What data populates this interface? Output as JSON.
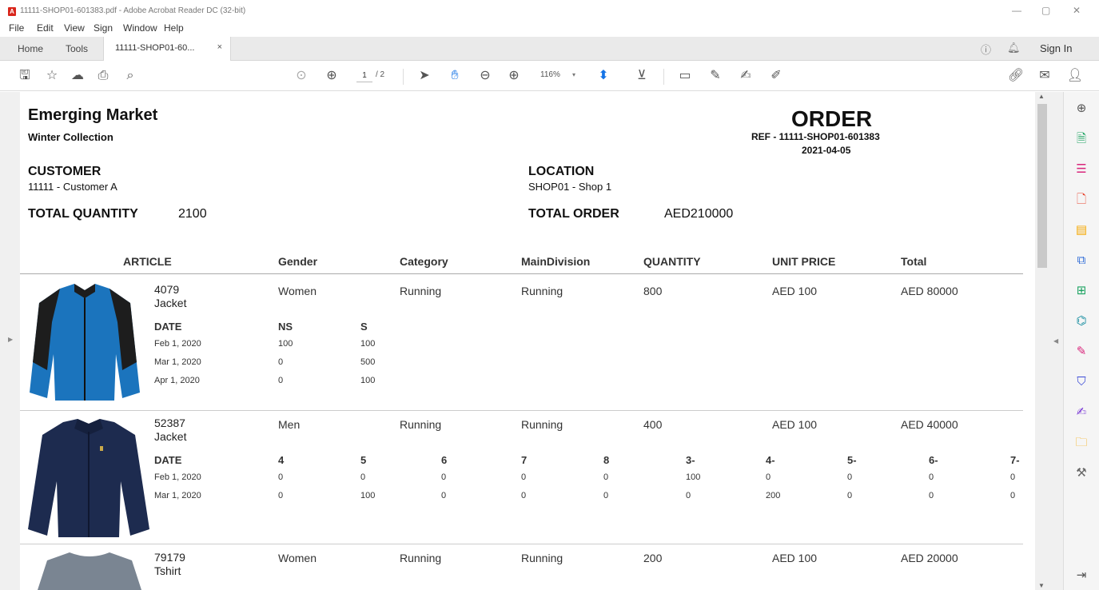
{
  "window": {
    "title": "11111-SHOP01-601383.pdf - Adobe Acrobat Reader DC (32-bit)",
    "minimize": "—",
    "restore": "▢",
    "close": "✕"
  },
  "menu": [
    "File",
    "Edit",
    "View",
    "Sign",
    "Window",
    "Help"
  ],
  "tabs": {
    "home": "Home",
    "tools": "Tools",
    "document": "11111-SHOP01-60...",
    "close": "×",
    "sign_in": "Sign In"
  },
  "toolbar": {
    "page_current": "1",
    "page_total": "/ 2",
    "zoom": "116%"
  },
  "document": {
    "company": "Emerging Market",
    "collection": "Winter Collection",
    "order_title": "ORDER",
    "ref": "REF - 11111-SHOP01-601383",
    "date": "2021-04-05",
    "customer_label": "CUSTOMER",
    "customer_value": "11111 - Customer A",
    "location_label": "LOCATION",
    "location_value": "SHOP01 - Shop 1",
    "total_quantity_label": "TOTAL QUANTITY",
    "total_quantity_value": "2100",
    "total_order_label": "TOTAL ORDER",
    "total_order_value": "AED210000",
    "headers": {
      "article": "ARTICLE",
      "gender": "Gender",
      "category": "Category",
      "main_division": "MainDivision",
      "quantity": "QUANTITY",
      "unit_price": "UNIT PRICE",
      "total": "Total"
    },
    "articles": [
      {
        "number": "4079",
        "name": "Jacket",
        "gender": "Women",
        "category": "Running",
        "main_division": "Running",
        "quantity": "800",
        "unit_price": "AED 100",
        "total": "AED 80000",
        "colors": {
          "body": "#1b74bd",
          "panel": "#1d1d1d"
        },
        "sizes": [
          "DATE",
          "NS",
          "S"
        ],
        "rows": [
          [
            "Feb 1, 2020",
            "100",
            "100"
          ],
          [
            "Mar 1, 2020",
            "0",
            "500"
          ],
          [
            "Apr 1, 2020",
            "0",
            "100"
          ]
        ]
      },
      {
        "number": "52387",
        "name": "Jacket",
        "gender": "Men",
        "category": "Running",
        "main_division": "Running",
        "quantity": "400",
        "unit_price": "AED 100",
        "total": "AED 40000",
        "colors": {
          "body": "#1d2b4f",
          "panel": "#15203d"
        },
        "sizes": [
          "DATE",
          "4",
          "5",
          "6",
          "7",
          "8",
          "3-",
          "4-",
          "5-",
          "6-",
          "7-"
        ],
        "rows": [
          [
            "Feb 1, 2020",
            "0",
            "0",
            "0",
            "0",
            "0",
            "100",
            "0",
            "0",
            "0",
            "0"
          ],
          [
            "Mar 1, 2020",
            "0",
            "100",
            "0",
            "0",
            "0",
            "0",
            "200",
            "0",
            "0",
            "0"
          ]
        ]
      },
      {
        "number": "79179",
        "name": "Tshirt",
        "gender": "Women",
        "category": "Running",
        "main_division": "Running",
        "quantity": "200",
        "unit_price": "AED 100",
        "total": "AED 20000",
        "colors": {
          "body": "#7a8592"
        }
      }
    ]
  }
}
